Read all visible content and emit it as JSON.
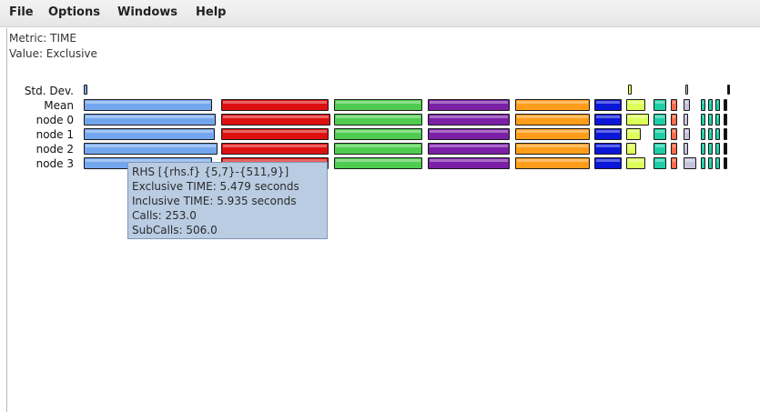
{
  "menu": {
    "file": "File",
    "options": "Options",
    "windows": "Windows",
    "help": "Help"
  },
  "info": {
    "metric": "Metric: TIME",
    "value": "Value: Exclusive"
  },
  "rows": [
    "Std. Dev.",
    "Mean",
    "node 0",
    "node 1",
    "node 2",
    "node 3"
  ],
  "colors": {
    "blue_light": "#74a6ee",
    "red": "#dd1010",
    "green": "#4fcc4f",
    "purple": "#7a1fa6",
    "orange": "#ff9c1a",
    "blue": "#0a16d8",
    "yellow_green": "#ddff5a",
    "teal": "#1ccfa6",
    "salmon": "#ff6a4a",
    "lavender": "#c7c3de",
    "black": "#111111"
  },
  "tooltip": {
    "line1": "RHS [{rhs.f} {5,7}-{511,9}]",
    "line2": "Exclusive TIME: 5.479 seconds",
    "line3": "Inclusive TIME: 5.935 seconds",
    "line4": "Calls: 253.0",
    "line5": "SubCalls: 506.0"
  }
}
